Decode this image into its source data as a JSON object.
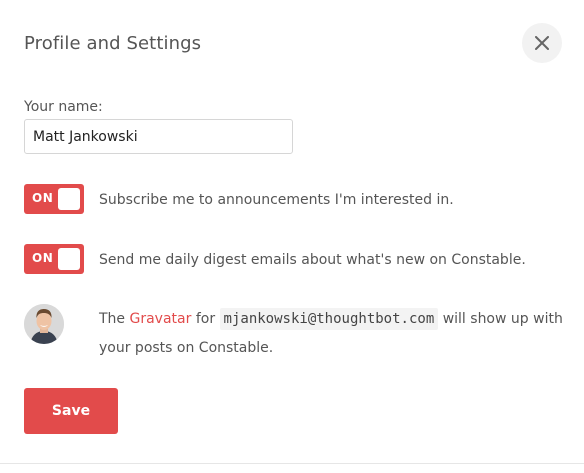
{
  "modal": {
    "title": "Profile and Settings",
    "close_icon": "close-icon"
  },
  "name_field": {
    "label": "Your name:",
    "value": "Matt Jankowski"
  },
  "toggles": [
    {
      "state_text": "ON",
      "on": true,
      "label": "Subscribe me to announcements I'm interested in."
    },
    {
      "state_text": "ON",
      "on": true,
      "label": "Send me daily digest emails about what's new on Constable."
    }
  ],
  "gravatar": {
    "prefix": "The ",
    "link_text": "Gravatar",
    "middle": " for ",
    "email": "mjankowski@thoughtbot.com",
    "suffix": " will show up with your posts on Constable."
  },
  "actions": {
    "save_label": "Save"
  },
  "colors": {
    "accent": "#e24b4b",
    "text": "#555555",
    "input_border": "#d6d6d6"
  }
}
